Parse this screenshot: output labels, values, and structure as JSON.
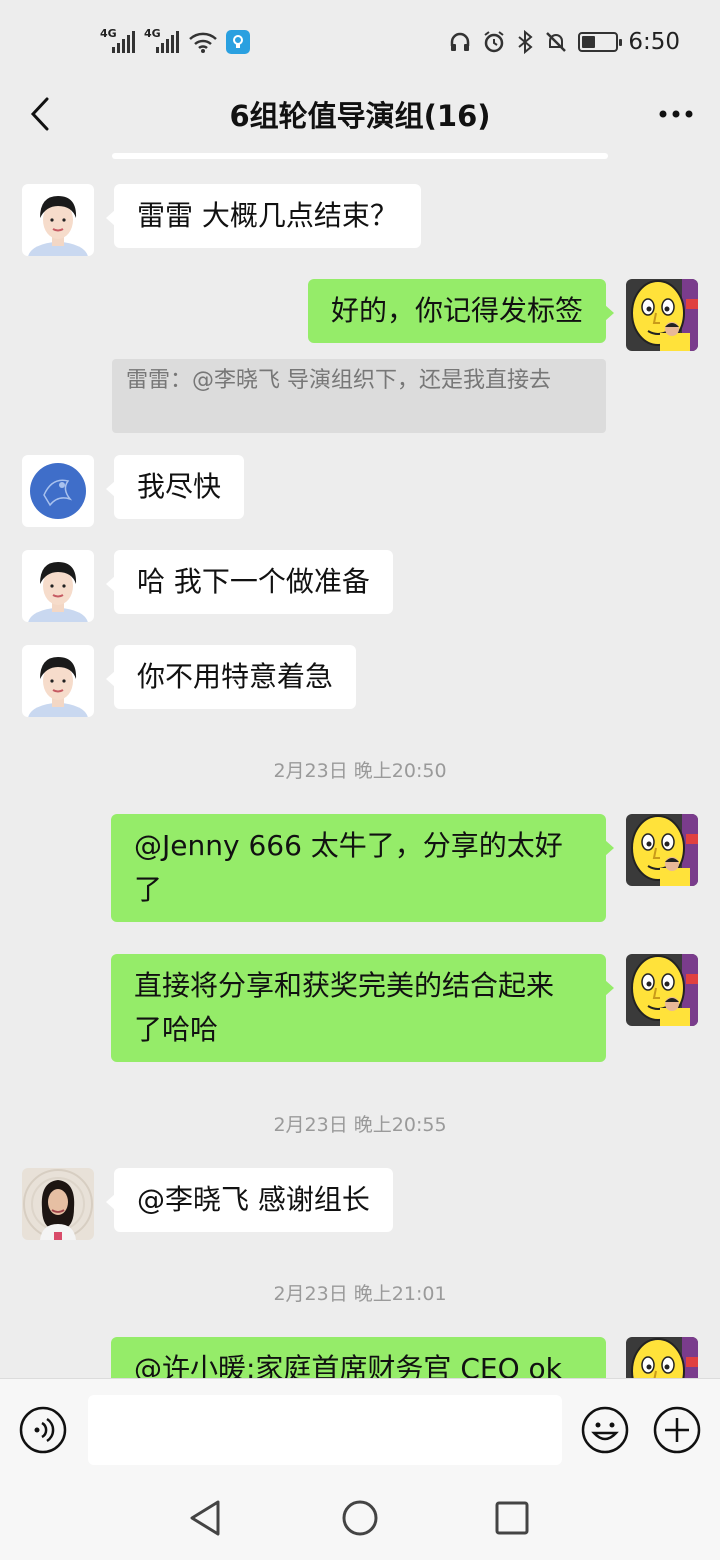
{
  "status_bar": {
    "network_1": "4G",
    "network_2": "4G",
    "time": "6:50",
    "battery_level": 0.4
  },
  "header": {
    "title": "6组轮值导演组(16)"
  },
  "messages": [
    {
      "text": "雷雷 大概几点结束？",
      "direction": "in",
      "avatar": "woman-portrait"
    },
    {
      "text": "好的，你记得发标签",
      "direction": "out",
      "avatar": "cartoon-yellow-face"
    },
    {
      "quote": "雷雷：@李晓飞 导演组织下，还是我直接去"
    },
    {
      "text": "我尽快",
      "direction": "in",
      "avatar": "blue-circle-logo"
    },
    {
      "text": "哈  我下一个做准备",
      "direction": "in",
      "avatar": "woman-portrait"
    },
    {
      "text": "你不用特意着急",
      "direction": "in",
      "avatar": "woman-portrait"
    },
    {
      "timestamp": "2月23日 晚上20:50"
    },
    {
      "text_line1": "@Jenny 666 太牛了，分享的太好",
      "text_line2": "了",
      "direction": "out",
      "avatar": "cartoon-yellow-face"
    },
    {
      "text_line1": "直接将分享和获奖完美的结合起来",
      "text_line2": "了哈哈",
      "direction": "out",
      "avatar": "cartoon-yellow-face"
    },
    {
      "timestamp": "2月23日 晚上20:55"
    },
    {
      "text": "@李晓飞  感谢组长",
      "direction": "in",
      "avatar": "woman-selfie"
    },
    {
      "timestamp": "2月23日 晚上21:01"
    },
    {
      "text": "@许小暖:家庭首席财务官 CEO ok",
      "direction": "out",
      "avatar": "cartoon-yellow-face"
    }
  ],
  "input_bar": {
    "voice_icon": "voice-icon",
    "emoji_icon": "emoji-icon",
    "plus_icon": "plus-icon"
  },
  "nav_bar": {
    "back": "triangle-back-icon",
    "home": "circle-home-icon",
    "recent": "square-recent-icon"
  }
}
